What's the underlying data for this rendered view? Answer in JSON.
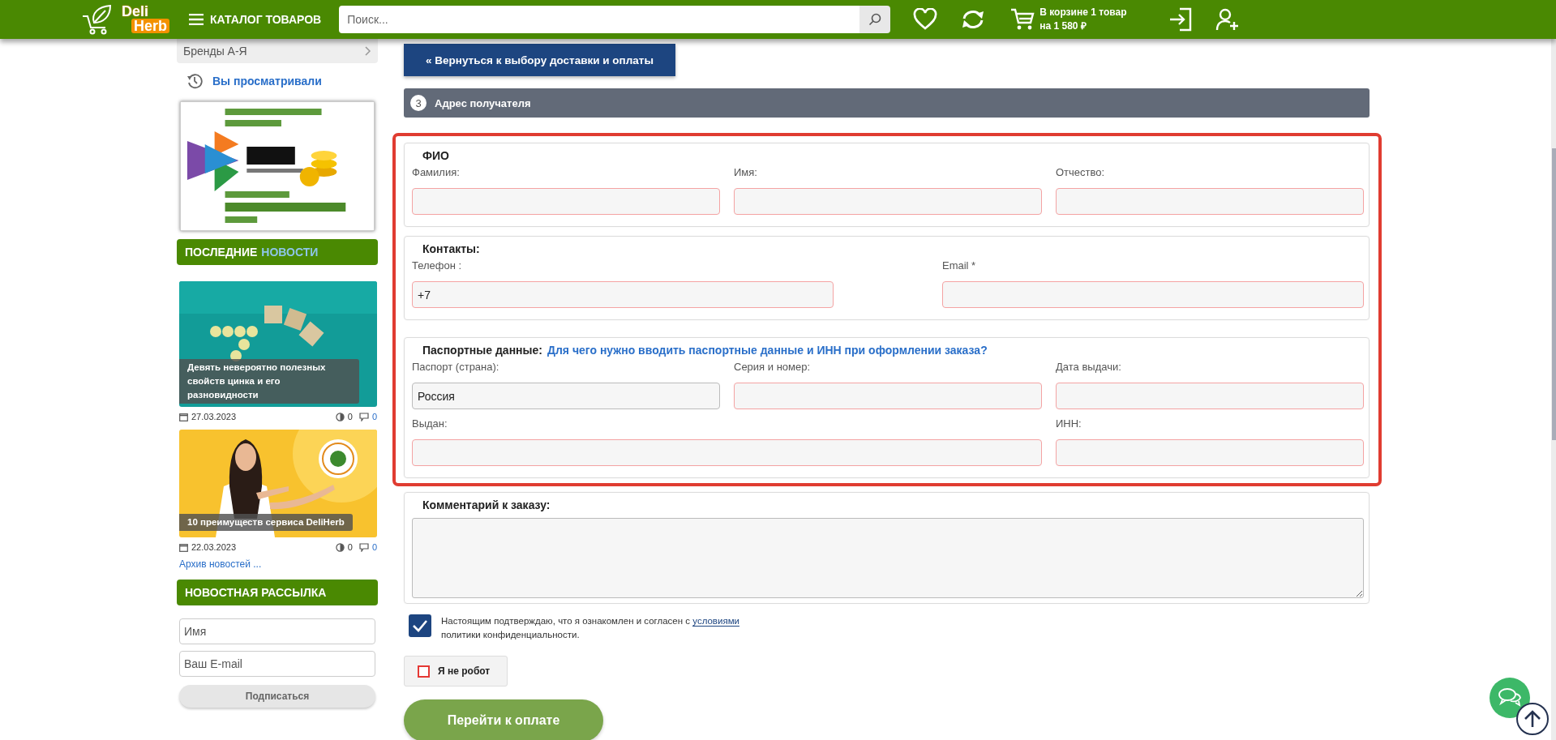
{
  "header": {
    "logo": {
      "first": "Deli",
      "second": "Herb"
    },
    "catalog_button": "КАТАЛОГ ТОВАРОВ",
    "search": {
      "placeholder": "Поиск..."
    },
    "cart": {
      "line_1": "В корзине 1 товар",
      "line_2": "на 1 580 ₽"
    }
  },
  "sidebar": {
    "brands_item": "Бренды А-Я",
    "viewed_link": "Вы просматривали",
    "news_heading": [
      {
        "text": "ПОСЛЕДНИЕ",
        "accent": false
      },
      {
        "text": "НОВОСТИ",
        "accent": true
      }
    ],
    "news": [
      {
        "title": "Девять невероятно полезных свойств цинка и его разновидности",
        "date": "27.03.2023",
        "views": "0",
        "comments": "0"
      },
      {
        "title": "10 преимуществ сервиса DeliHerb",
        "date": "22.03.2023",
        "views": "0",
        "comments": "0"
      }
    ],
    "archive_link": "Архив новостей ...",
    "newsletter": {
      "heading": "НОВОСТНАЯ РАССЫЛКА",
      "name_placeholder": "Имя",
      "email_placeholder": "Ваш E-mail",
      "subscribe_button": "Подписаться"
    }
  },
  "main": {
    "back_button": "« Вернуться к выбору доставки и оплаты",
    "step": {
      "number": "3",
      "title": "Адрес получателя"
    },
    "form_group": {
      "highlighted": true
    },
    "fieldsets": [
      {
        "kind": "name",
        "legend": "ФИО",
        "fields": [
          {
            "label": "Фамилия:",
            "invalid": true
          },
          {
            "label": "Имя:",
            "invalid": true
          },
          {
            "label": "Отчество:",
            "invalid": true
          }
        ]
      },
      {
        "kind": "contacts",
        "legend": "Контакты:",
        "fields": [
          {
            "label": "Телефон :",
            "value": "+7",
            "invalid": true
          },
          {
            "label": "Email *",
            "invalid": true
          }
        ]
      },
      {
        "kind": "passport",
        "legend": "Паспортные данные:",
        "link": "Для чего нужно вводить паспортные данные и ИНН при оформлении заказа?",
        "fields": [
          {
            "label": "Паспорт (страна):",
            "value": "Россия",
            "invalid": false
          },
          {
            "label": "Серия и номер:",
            "invalid": true
          },
          {
            "label": "Дата выдачи:",
            "invalid": true
          },
          {
            "label": "Выдан:",
            "invalid": true
          },
          {
            "label": "ИНН:",
            "invalid": true
          }
        ]
      }
    ],
    "comment": {
      "legend": "Комментарий к заказу:"
    },
    "consent": {
      "checked": true,
      "text": "Настоящим подтверждаю, что я ознакомлен и согласен с",
      "link": "условиями",
      "text_2": "политики конфиденциальности."
    },
    "captcha": {
      "checked": false,
      "label": "Я не робот"
    },
    "pay_button": "Перейти к оплате"
  }
}
